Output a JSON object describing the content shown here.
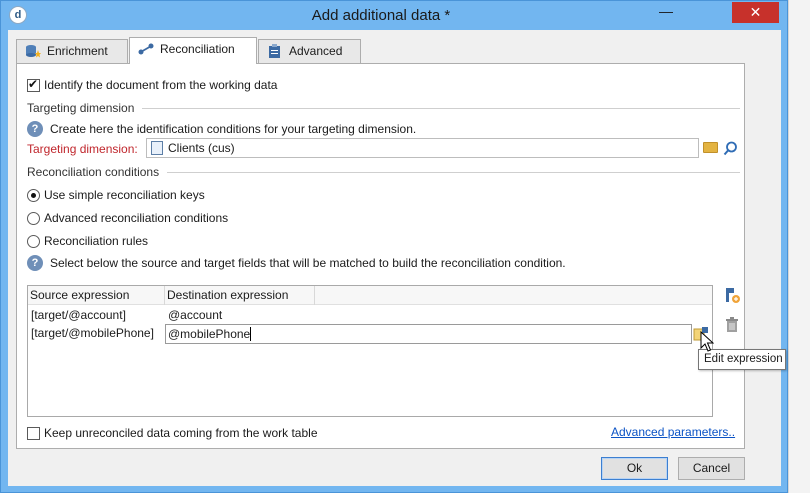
{
  "window": {
    "title": "Add additional data *",
    "minimize_glyph": "—",
    "close_glyph": "✕",
    "app_icon_glyph": "d"
  },
  "tabs": [
    {
      "label": "Enrichment",
      "icon": "database-star-icon",
      "active": false
    },
    {
      "label": "Reconciliation",
      "icon": "link-nodes-icon",
      "active": true
    },
    {
      "label": "Advanced",
      "icon": "clipboard-icon",
      "active": false
    }
  ],
  "reconciliation": {
    "identify_checkbox": {
      "label": "Identify the document from the working data",
      "checked": true
    },
    "targeting_section": "Targeting dimension",
    "targeting_help": "Create here the identification conditions for your targeting dimension.",
    "targeting_label": "Targeting dimension:",
    "targeting_value": "Clients (cus)",
    "conditions_section": "Reconciliation conditions",
    "options": [
      {
        "label": "Use simple reconciliation keys",
        "checked": true
      },
      {
        "label": "Advanced reconciliation conditions",
        "checked": false
      },
      {
        "label": "Reconciliation rules",
        "checked": false
      }
    ],
    "grid_help": "Select below the source and target fields that will be matched to build the reconciliation condition.",
    "grid": {
      "columns": [
        "Source expression",
        "Destination expression"
      ],
      "rows": [
        {
          "source": "[target/@account]",
          "destination": "@account"
        },
        {
          "source": "[target/@mobilePhone]",
          "destination": "@mobilePhone"
        }
      ]
    },
    "tooltip": "Edit expression",
    "keep_checkbox": {
      "label": "Keep unreconciled data coming from the work table",
      "checked": false
    },
    "advanced_link": "Advanced parameters.."
  },
  "buttons": {
    "ok": "Ok",
    "cancel": "Cancel"
  },
  "colors": {
    "titlebar": "#72b6f0",
    "close": "#c7312b",
    "required_label": "#c0262c",
    "link": "#0b53c5"
  }
}
